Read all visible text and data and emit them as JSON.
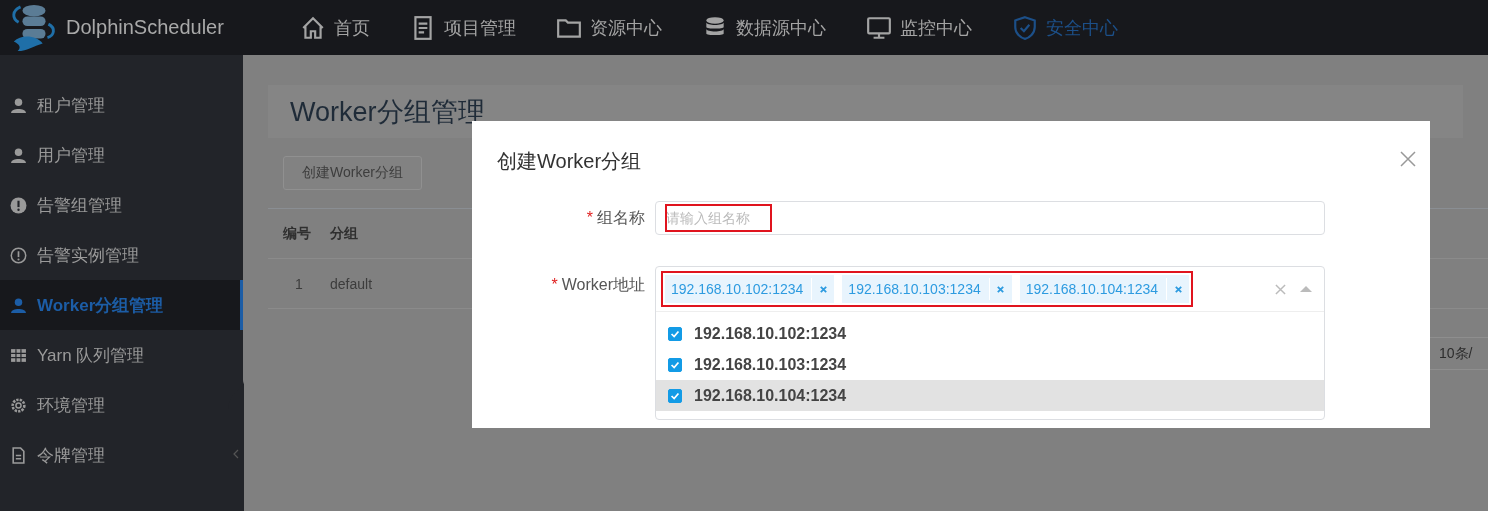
{
  "header": {
    "app_name": "DolphinScheduler",
    "nav": [
      {
        "label": "首页",
        "selected": false
      },
      {
        "label": "项目管理",
        "selected": false
      },
      {
        "label": "资源中心",
        "selected": false
      },
      {
        "label": "数据源中心",
        "selected": false
      },
      {
        "label": "监控中心",
        "selected": false
      },
      {
        "label": "安全中心",
        "selected": true
      }
    ]
  },
  "sidebar": {
    "items": [
      {
        "label": "租户管理",
        "selected": false
      },
      {
        "label": "用户管理",
        "selected": false
      },
      {
        "label": "告警组管理",
        "selected": false
      },
      {
        "label": "告警实例管理",
        "selected": false
      },
      {
        "label": "Worker分组管理",
        "selected": true
      },
      {
        "label": "Yarn 队列管理",
        "selected": false
      },
      {
        "label": "环境管理",
        "selected": false
      },
      {
        "label": "令牌管理",
        "selected": false
      }
    ]
  },
  "page": {
    "title": "Worker分组管理",
    "create_button": "创建Worker分组",
    "table": {
      "columns": [
        "编号",
        "分组"
      ],
      "rows": [
        [
          "1",
          "default"
        ]
      ]
    },
    "page_size": "10条/"
  },
  "dialog": {
    "title": "创建Worker分组",
    "fields": [
      {
        "kind": "text",
        "required_mark": "*",
        "label": "组名称",
        "placeholder": "请输入组名称",
        "highlighted": true
      },
      {
        "kind": "multiselect",
        "required_mark": "*",
        "label": "Worker地址",
        "highlighted": true,
        "expanded": true,
        "tags": [
          "192.168.10.102:1234",
          "192.168.10.103:1234",
          "192.168.10.104:1234"
        ],
        "options": [
          {
            "label": "192.168.10.102:1234",
            "checked": true,
            "hovered": false
          },
          {
            "label": "192.168.10.103:1234",
            "checked": true,
            "hovered": false
          },
          {
            "label": "192.168.10.104:1234",
            "checked": true,
            "hovered": true
          }
        ]
      }
    ]
  }
}
